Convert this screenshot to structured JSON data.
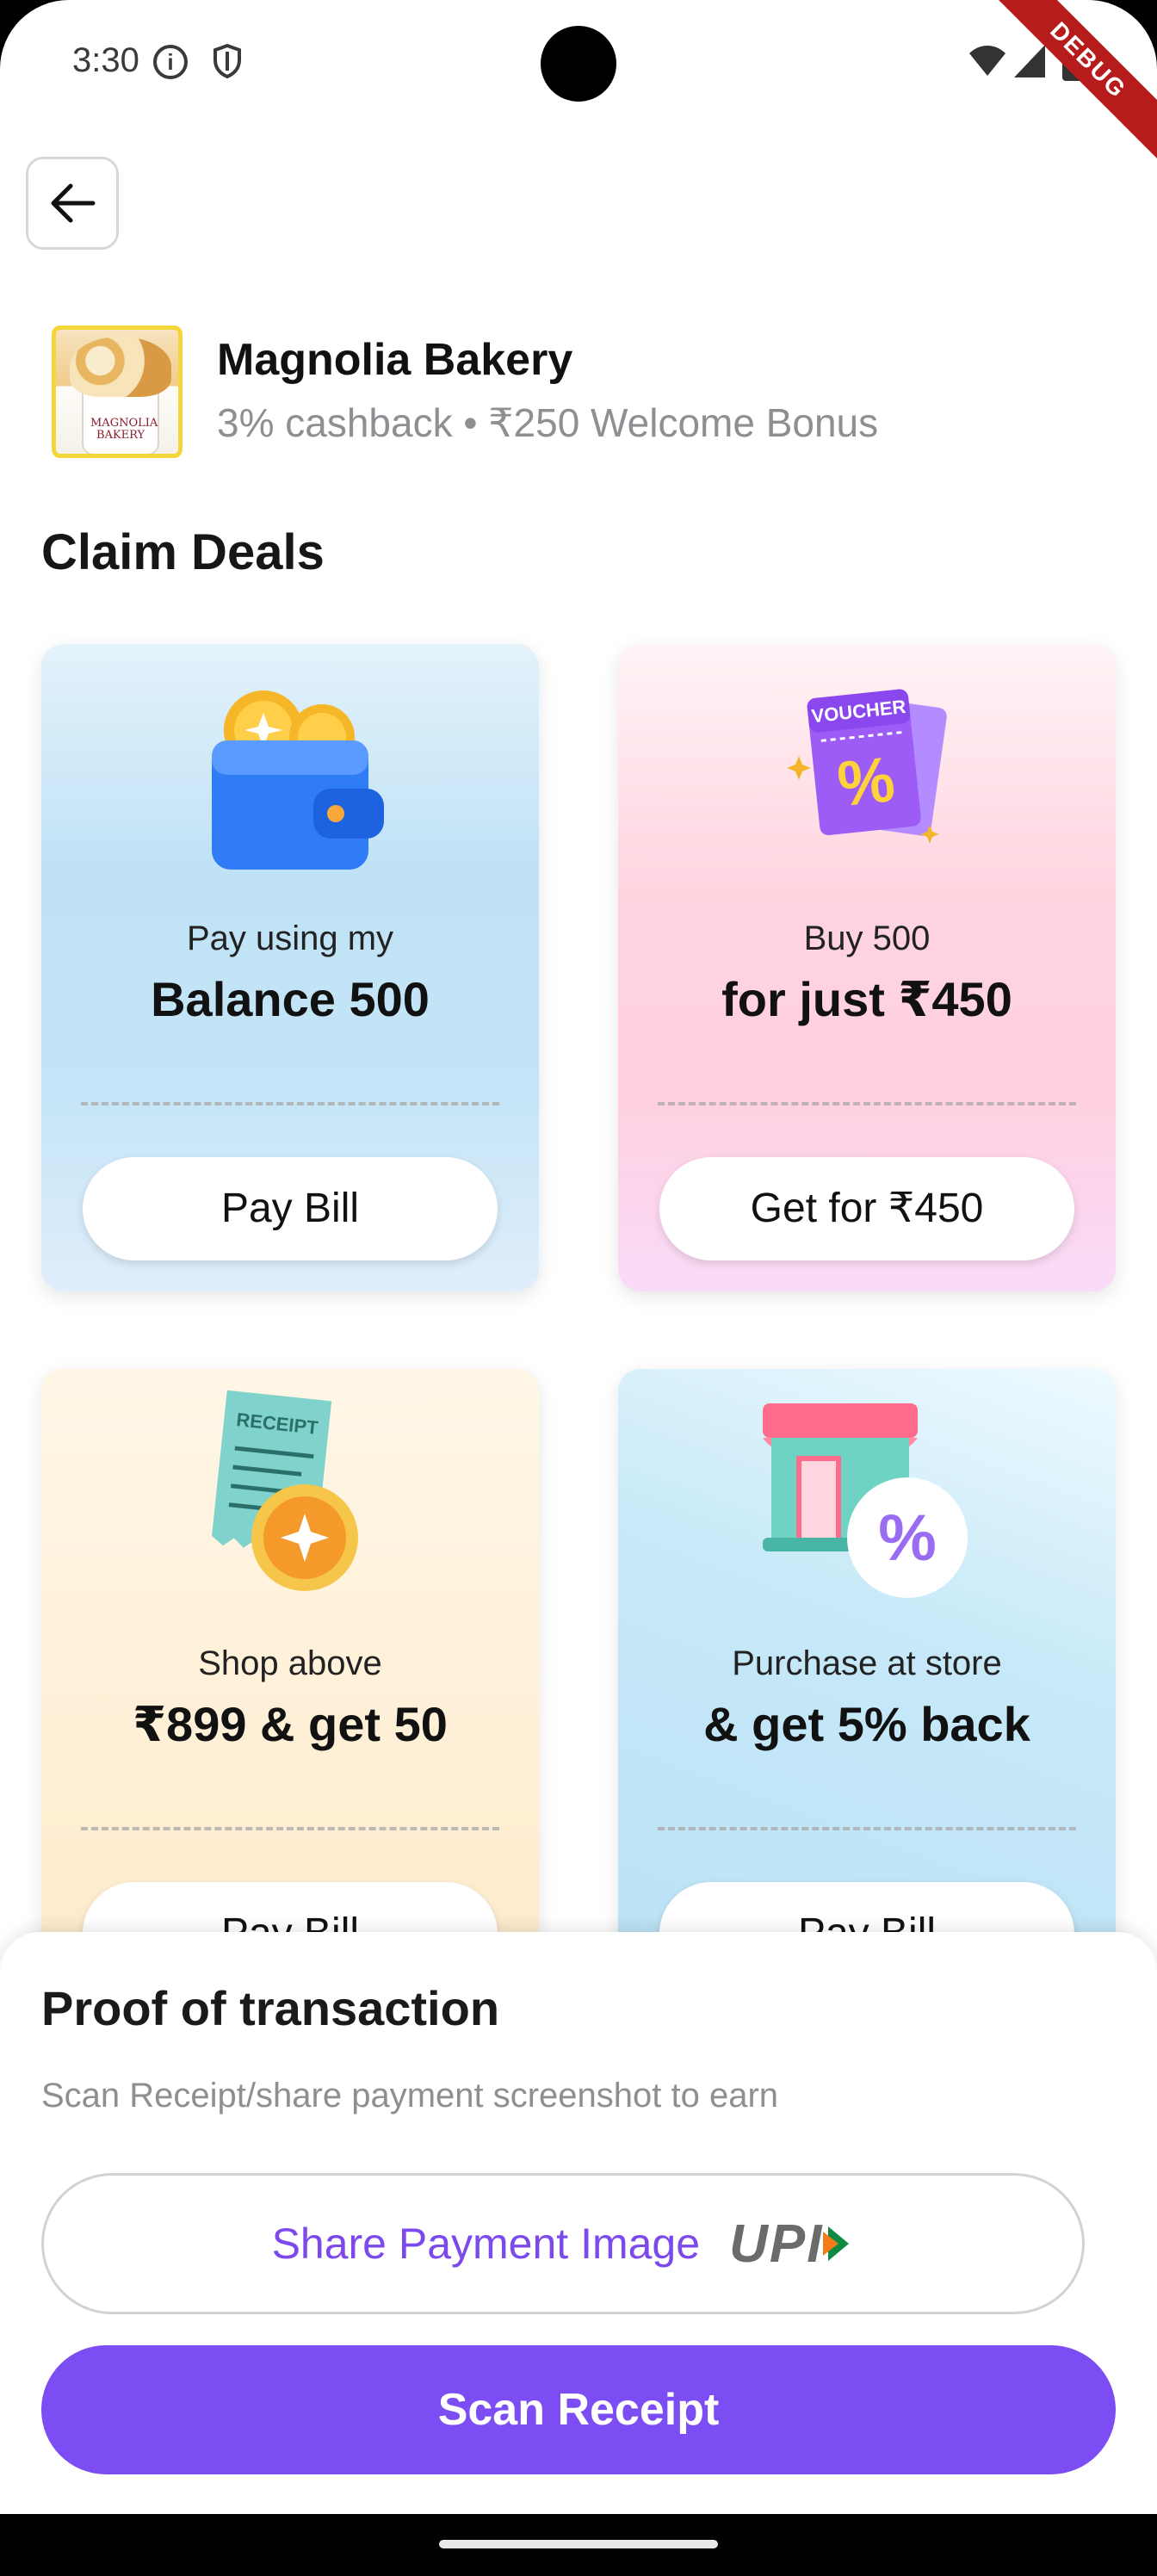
{
  "status_bar": {
    "time": "3:30",
    "debug_label": "DEBUG",
    "info_glyph": "i"
  },
  "header": {
    "back_icon": "arrow-left-icon"
  },
  "store": {
    "name": "Magnolia Bakery",
    "subtitle": "3% cashback • ₹250 Welcome Bonus",
    "logo_text": "MAGNOLIA BAKERY"
  },
  "deals_section": {
    "title": "Claim Deals",
    "cards": [
      {
        "illustration": "wallet-icon",
        "line1": "Pay using my",
        "line2": "Balance 500",
        "button": "Pay Bill"
      },
      {
        "illustration": "voucher-icon",
        "line1": "Buy 500",
        "line2": "for just ₹450",
        "button": "Get for ₹450",
        "illustration_text": "VOUCHER"
      },
      {
        "illustration": "receipt-icon",
        "line1": "Shop above",
        "line2": "₹899 & get 50",
        "button": "Pay Bill",
        "illustration_text": "RECEIPT"
      },
      {
        "illustration": "store-percent-icon",
        "line1": "Purchase at store",
        "line2": "& get 5% back",
        "button": "Pay Bill"
      }
    ]
  },
  "bottom_sheet": {
    "title": "Proof of transaction",
    "subtitle": "Scan Receipt/share payment screenshot to earn",
    "share_label": "Share Payment Image",
    "upi_label": "UPI",
    "scan_label": "Scan Receipt"
  },
  "colors": {
    "accent": "#7b4df2",
    "share_text": "#7b49ec",
    "muted_text": "#8e8e93"
  }
}
